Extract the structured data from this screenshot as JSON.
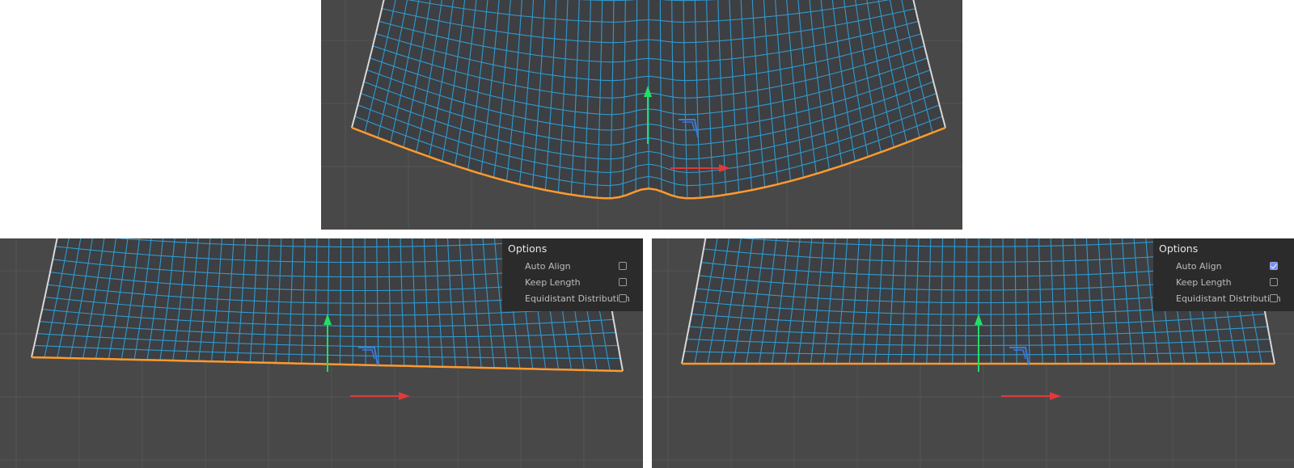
{
  "colors": {
    "viewport_bg": "#484848",
    "grid_line": "#555555",
    "mesh_line": "#2f9ad0",
    "border_edge": "#d8d8d8",
    "selected_edge": "#ff9a2e",
    "gizmo_y": "#22dd66",
    "gizmo_x": "#e03a3a",
    "gizmo_plane": "#3b7be0",
    "panel_bg": "#2b2b2b",
    "checkbox_checked": "#7c8ef0"
  },
  "viewports": [
    {
      "id": "top",
      "description_name": "original-viewport"
    },
    {
      "id": "left",
      "options": {
        "title": "Options",
        "items": [
          {
            "label": "Auto Align",
            "checked": false
          },
          {
            "label": "Keep Length",
            "checked": false
          },
          {
            "label": "Equidistant Distribution",
            "checked": false
          }
        ]
      }
    },
    {
      "id": "right",
      "options": {
        "title": "Options",
        "items": [
          {
            "label": "Auto Align",
            "checked": true
          },
          {
            "label": "Keep Length",
            "checked": false
          },
          {
            "label": "Equidistant Distribution",
            "checked": false
          }
        ]
      }
    }
  ]
}
